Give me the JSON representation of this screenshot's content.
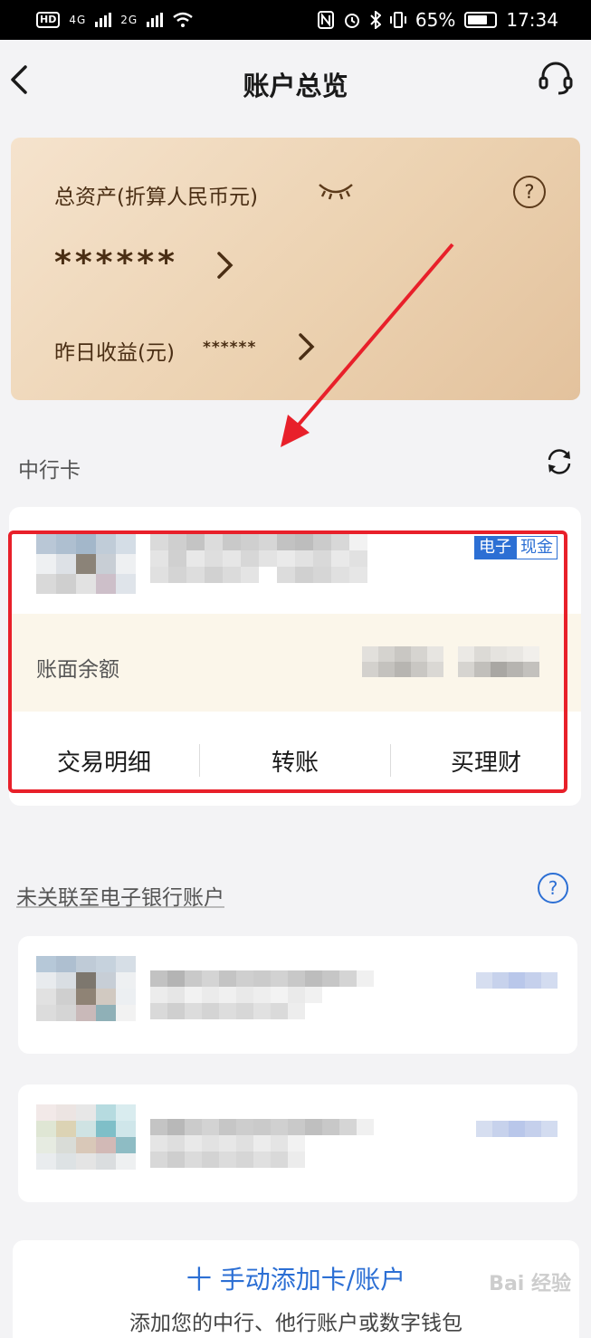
{
  "status_bar": {
    "left_labels": [
      "HD",
      "4G",
      "2G"
    ],
    "battery_percent": "65%",
    "time": "17:34"
  },
  "header": {
    "title": "账户总览",
    "icons": [
      "back-arrow-icon",
      "customer-service-headset-icon"
    ]
  },
  "asset_card": {
    "total_label": "总资产(折算人民币元)",
    "total_value": "******",
    "yesterday_label": "昨日收益(元)",
    "yesterday_value": "******",
    "icons": [
      "eye-closed-icon",
      "question-icon",
      "chevron-right-icon"
    ]
  },
  "boc_section": {
    "label": "中行卡",
    "card": {
      "tags": [
        "电子",
        "现金"
      ],
      "balance_label": "账面余额",
      "actions": [
        "交易明细",
        "转账",
        "买理财"
      ]
    }
  },
  "unlinked_section": {
    "label": "未关联至电子银行账户"
  },
  "add_account": {
    "title": "十 手动添加卡/账户",
    "subtitle": "添加您的中行、他行账户或数字钱包"
  },
  "watermark": "Bai 经验",
  "colors": {
    "accent_blue": "#2c6fd4",
    "highlight_red": "#e8202a",
    "gold_card": "#ecd2b1"
  }
}
